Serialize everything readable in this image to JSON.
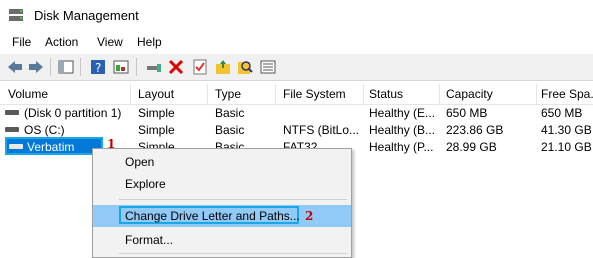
{
  "window": {
    "title": "Disk Management"
  },
  "menu": [
    "File",
    "Action",
    "View",
    "Help"
  ],
  "toolbar_icons": [
    "back-arrow-icon",
    "forward-arrow-icon",
    "console-tree-icon",
    "help-icon",
    "properties-icon",
    "connect-icon",
    "delete-icon",
    "checkmark-icon",
    "open-folder-icon",
    "search-icon",
    "list-view-icon"
  ],
  "columns": [
    "Volume",
    "Layout",
    "Type",
    "File System",
    "Status",
    "Capacity",
    "Free Spa..."
  ],
  "rows": [
    {
      "volume": "(Disk 0 partition 1)",
      "layout": "Simple",
      "type": "Basic",
      "fs": "",
      "status": "Healthy (E...",
      "capacity": "650 MB",
      "free": "650 MB"
    },
    {
      "volume": "OS (C:)",
      "layout": "Simple",
      "type": "Basic",
      "fs": "NTFS (BitLo...",
      "status": "Healthy (B...",
      "capacity": "223.86 GB",
      "free": "41.30 GB"
    },
    {
      "volume": "Verbatim",
      "layout": "Simple",
      "type": "Basic",
      "fs": "FAT32",
      "status": "Healthy (P...",
      "capacity": "28.99 GB",
      "free": "21.10 GB"
    }
  ],
  "annotations": {
    "marker1": "1",
    "marker2": "2"
  },
  "context_menu": [
    "Open",
    "Explore",
    "Change Drive Letter and Paths...",
    "Format..."
  ],
  "colors": {
    "selection": "#0078d7",
    "highlight_box": "#1aa7e8",
    "menu_hover": "#91c9f7",
    "marker": "#c00000"
  }
}
